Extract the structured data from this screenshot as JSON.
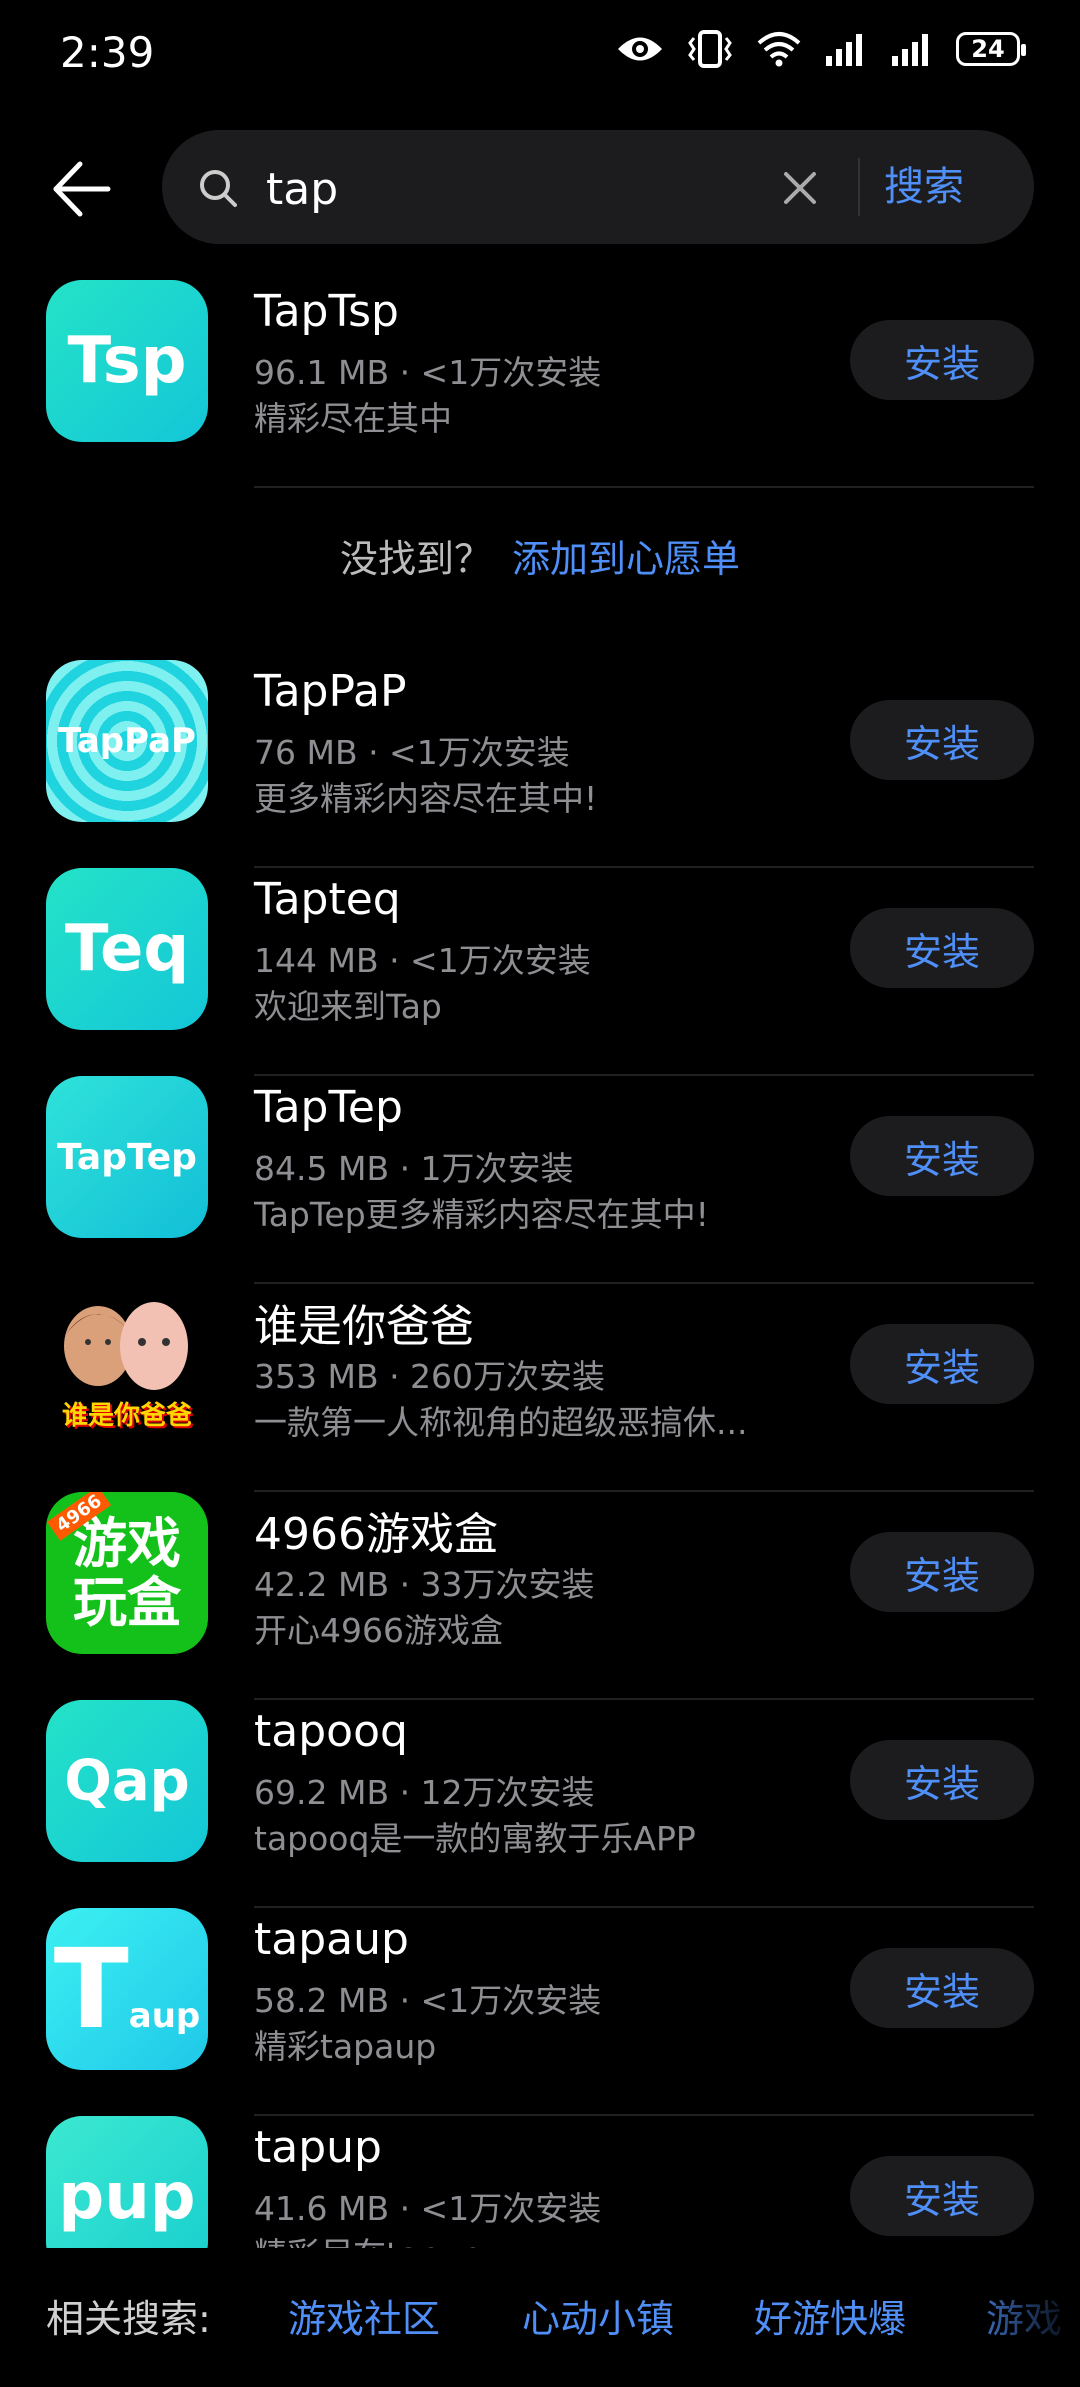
{
  "status_bar": {
    "time": "2:39",
    "battery": "24"
  },
  "search": {
    "query": "tap",
    "button_label": "搜索"
  },
  "first_app": {
    "name": "TapTsp",
    "meta": "96.1 MB · <1万次安装",
    "desc": "精彩尽在其中",
    "icon_text": "Tsp",
    "install_label": "安装"
  },
  "not_found": {
    "question": "没找到？",
    "link": "添加到心愿单"
  },
  "apps": [
    {
      "name": "TapPaP",
      "meta": "76 MB · <1万次安装",
      "desc": "更多精彩内容尽在其中!",
      "icon_text": "TapPaP",
      "install_label": "安装"
    },
    {
      "name": "Tapteq",
      "meta": "144 MB · <1万次安装",
      "desc": "欢迎来到Tap",
      "icon_text": "Teq",
      "install_label": "安装"
    },
    {
      "name": "TapTep",
      "meta": "84.5 MB · 1万次安装",
      "desc": "TapTep更多精彩内容尽在其中!",
      "icon_text": "TapTep",
      "install_label": "安装"
    },
    {
      "name": "谁是你爸爸",
      "meta": "353 MB · 260万次安装",
      "desc": "一款第一人称视角的超级恶搞休...",
      "icon_text": "谁是你爸爸",
      "install_label": "安装"
    },
    {
      "name": "4966游戏盒",
      "meta": "42.2 MB · 33万次安装",
      "desc": "开心4966游戏盒",
      "icon_text": "游戏玩盒",
      "icon_badge": "4966",
      "install_label": "安装"
    },
    {
      "name": "tapooq",
      "meta": "69.2 MB · 12万次安装",
      "desc": "tapooq是一款的寓教于乐APP",
      "icon_text": "Qap",
      "install_label": "安装"
    },
    {
      "name": "tapaup",
      "meta": "58.2 MB · <1万次安装",
      "desc": "精彩tapaup",
      "icon_text": "T",
      "icon_sub": "aup",
      "install_label": "安装"
    },
    {
      "name": "tapup",
      "meta": "41.6 MB · <1万次安装",
      "desc": "精彩尽在tapup",
      "icon_text": "pup",
      "install_label": "安装"
    }
  ],
  "related": {
    "label": "相关搜索:",
    "items": [
      "游戏社区",
      "心动小镇",
      "好游快爆",
      "游戏"
    ]
  },
  "colors": {
    "accent": "#4f8ff7",
    "background": "#000000",
    "button_bg": "#1c1c1e"
  }
}
